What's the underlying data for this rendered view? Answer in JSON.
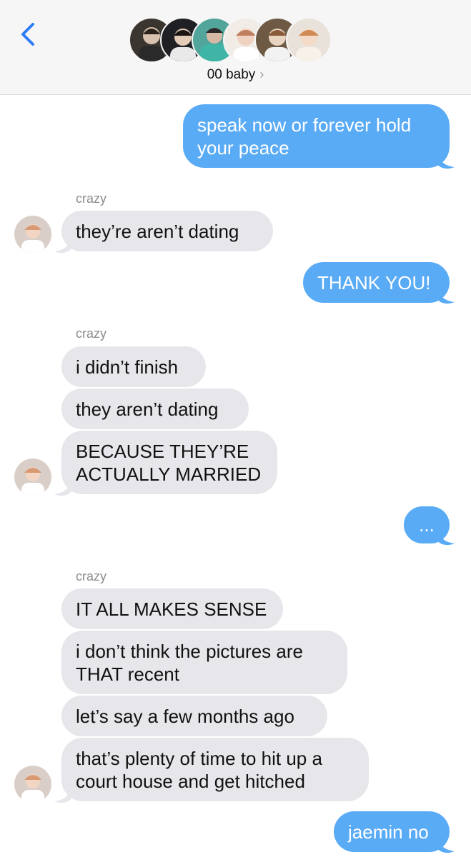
{
  "header": {
    "group_name": "00 baby",
    "chevron": "›",
    "avatars": [
      {
        "name": "member-1-avatar",
        "bg": "#3b3530",
        "fg": "#d8c1ae"
      },
      {
        "name": "member-2-avatar",
        "bg": "#1f2024",
        "fg": "#e3cbb8"
      },
      {
        "name": "member-3-avatar",
        "bg": "#51a59b",
        "fg": "#d6b9a4"
      },
      {
        "name": "member-4-avatar",
        "bg": "#f1ece6",
        "fg": "#f0d2c0"
      },
      {
        "name": "member-5-avatar",
        "bg": "#6e5a44",
        "fg": "#e9d3c1"
      },
      {
        "name": "member-6-avatar",
        "bg": "#e9e2da",
        "fg": "#f4dbc8"
      }
    ]
  },
  "messages": {
    "m1": "speak now or forever hold\nyour peace",
    "m2": "they’re aren’t dating",
    "m3": "THANK YOU!",
    "m4": "i didn’t finish",
    "m5": "they aren’t dating",
    "m6": "BECAUSE THEY’RE\nACTUALLY MARRIED",
    "m7": "...",
    "m8": "IT ALL MAKES SENSE",
    "m9": "i don’t think the pictures are\nTHAT recent",
    "m10": "let’s say a few months ago",
    "m11": "that’s plenty of time to hit up a\ncourt house and get hitched",
    "m12": "jaemin no"
  },
  "senders": {
    "s1": "crazy",
    "s2": "crazy",
    "s3": "crazy"
  },
  "colors": {
    "outgoing": "#5aabf6",
    "incoming": "#e6e6eb",
    "accent": "#2f7df6"
  }
}
